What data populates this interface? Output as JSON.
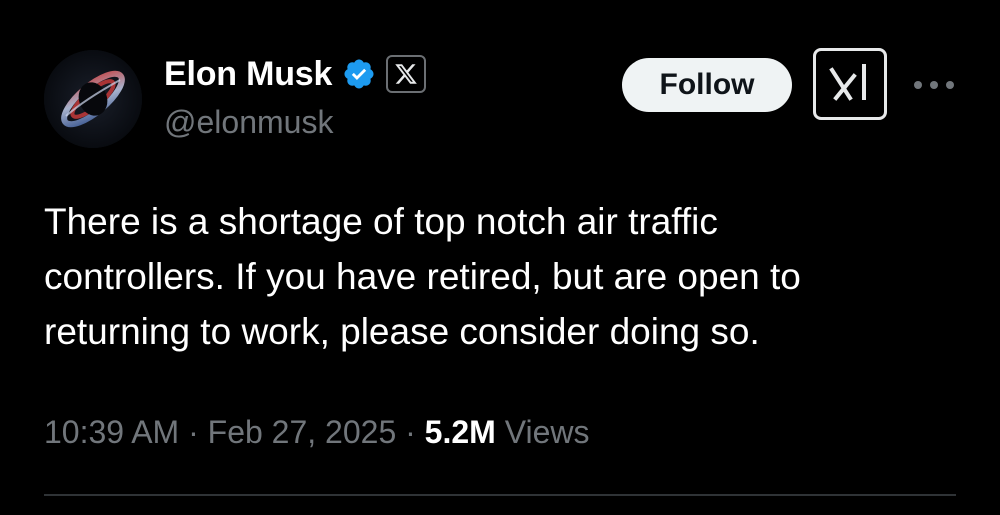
{
  "author": {
    "display_name": "Elon Musk",
    "handle": "@elonmusk",
    "verified_icon": "verified-badge-icon",
    "affiliate_icon": "x-logo-icon"
  },
  "actions": {
    "follow_label": "Follow",
    "grok_icon": "grok-icon",
    "more_icon": "more-options-icon"
  },
  "tweet": {
    "text": "There is a shortage of top notch air traffic\ncontrollers. If you have retired, but are open to\nreturning to work, please consider doing so.",
    "time": "10:39 AM",
    "separator": "·",
    "date": "Feb 27, 2025",
    "views_count": "5.2M",
    "views_label": "Views"
  },
  "colors": {
    "background": "#000000",
    "primary_text": "#e7e9ea",
    "secondary_text": "#71767b",
    "verified_blue": "#1d9bf0",
    "follow_button_bg": "#eff3f4",
    "divider": "#2f3336"
  }
}
